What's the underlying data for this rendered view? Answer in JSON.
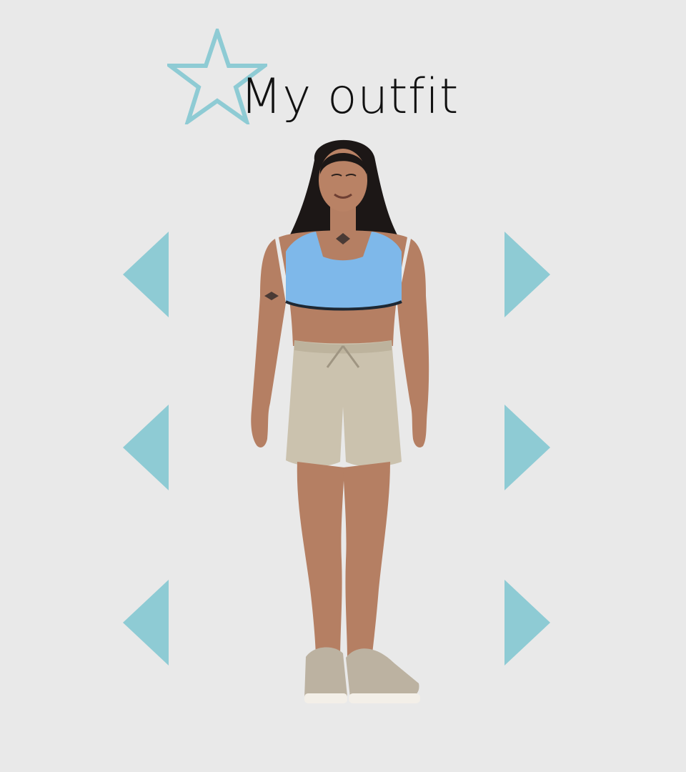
{
  "title": "My outfit",
  "colors": {
    "background": "#e9e9e9",
    "accent": "#8ecbd4",
    "title_text": "#111111"
  },
  "icons": {
    "star": "star-outline-icon",
    "prev": "triangle-left-icon",
    "next": "triangle-right-icon"
  },
  "rows": [
    {
      "name": "top",
      "prev": "previous-top",
      "next": "next-top"
    },
    {
      "name": "bottom",
      "prev": "previous-bottom",
      "next": "next-bottom"
    },
    {
      "name": "shoes",
      "prev": "previous-shoes",
      "next": "next-shoes"
    }
  ]
}
